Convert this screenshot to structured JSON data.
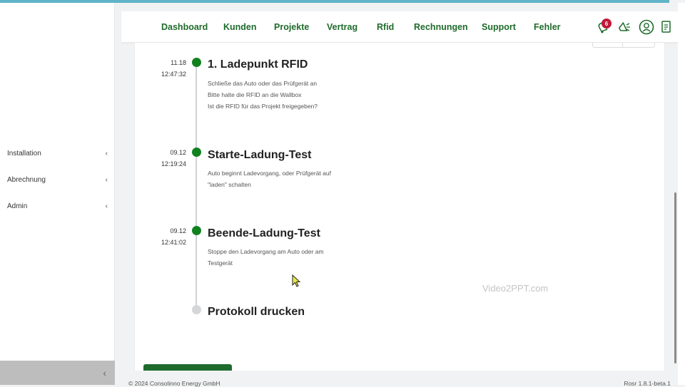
{
  "sidebar": {
    "items": [
      {
        "label": "Installation",
        "chevron": "‹"
      },
      {
        "label": "Abrechnung",
        "chevron": "‹"
      },
      {
        "label": "Admin",
        "chevron": "‹"
      }
    ],
    "collapse_glyph": "‹"
  },
  "nav": {
    "items": [
      "Dashboard",
      "Kunden",
      "Projekte",
      "Vertrag",
      "Rfid",
      "Rechnungen",
      "Support",
      "Fehler"
    ],
    "notification_count": "6",
    "icons": [
      "bell-icon",
      "megaphone-icon",
      "user-icon",
      "document-icon"
    ]
  },
  "timeline": [
    {
      "date": "11.18",
      "time": "12:47:32",
      "title": "1. Ladepunkt RFID",
      "lines": [
        "Schließe das Auto oder das Prüfgerät an",
        "Bitte halte die RFID an die Wallbox",
        "Ist die RFID für das Projekt freigegeben?"
      ]
    },
    {
      "date": "09.12",
      "time": "12:19:24",
      "title": "Starte-Ladung-Test",
      "lines": [
        "Auto beginnt Ladevorgang, oder Prüfgerät auf",
        "\"laden\" schalten"
      ]
    },
    {
      "date": "09.12",
      "time": "12:41:02",
      "title": "Beende-Ladung-Test",
      "lines": [
        "Stoppe den Ladevorgang am Auto oder am",
        "Testgerät"
      ]
    },
    {
      "date": "",
      "time": "",
      "title": "Protokoll drucken",
      "lines": []
    }
  ],
  "watermark": "Video2PPT.com",
  "footer": {
    "copyright": "© 2024 Consolinno Energy GmbH",
    "version": "Rosr 1.8.1-beta.1"
  },
  "colors": {
    "accent_green": "#1f6b2b",
    "dot_green": "#11811f",
    "badge_red": "#c0183a"
  }
}
